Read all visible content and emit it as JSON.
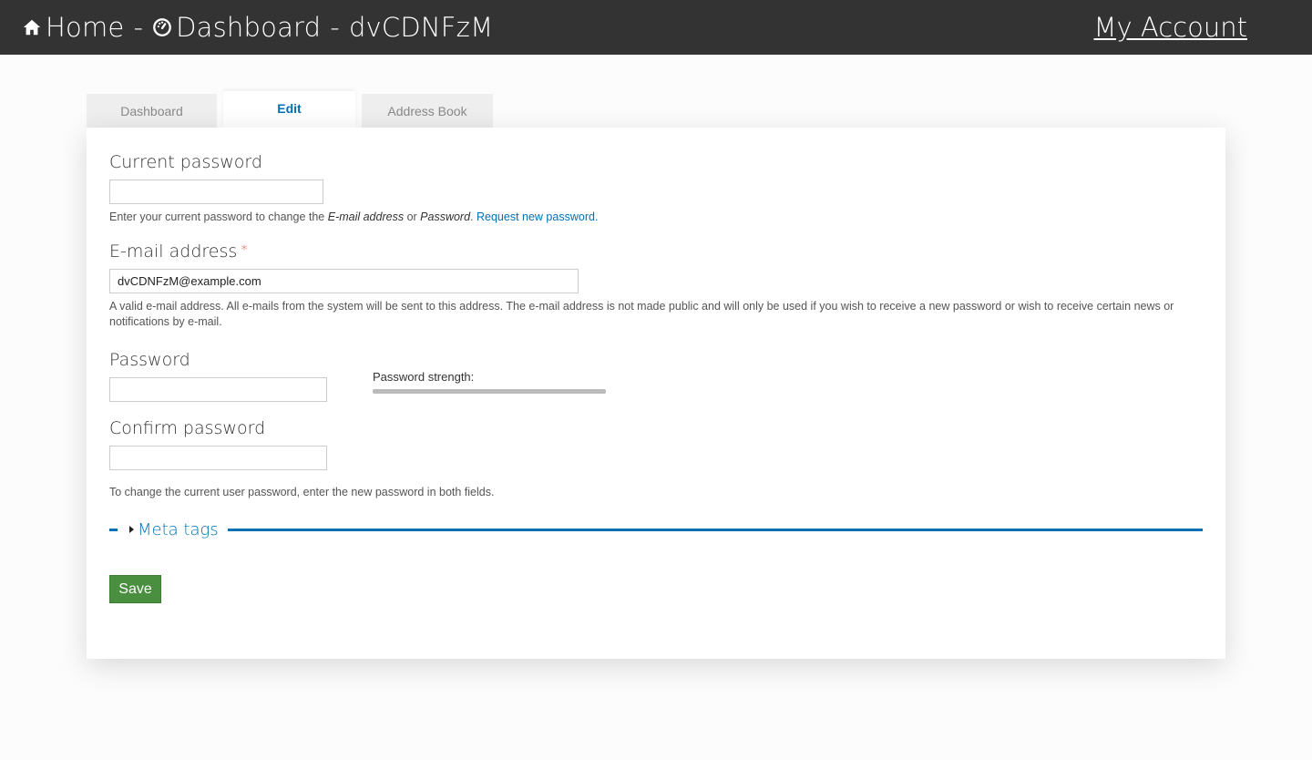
{
  "header": {
    "crumb_home": "Home",
    "crumb_sep1": "-",
    "crumb_dashboard": "Dashboard",
    "crumb_sep2": "-",
    "crumb_user": "dvCDNFzM",
    "account_link": "My Account",
    "bg_color": "#333333"
  },
  "tabs": [
    {
      "label": "Dashboard",
      "active": false
    },
    {
      "label": "Edit",
      "active": true
    },
    {
      "label": "Address Book",
      "active": false
    }
  ],
  "form": {
    "current_password": {
      "label": "Current password",
      "value": "",
      "desc_prefix": "Enter your current password to change the ",
      "desc_field1": "E-mail address",
      "desc_or": " or ",
      "desc_field2": "Password",
      "desc_dot": ". ",
      "desc_link": "Request new password",
      "desc_end": "."
    },
    "email": {
      "label": "E-mail address",
      "required_mark": "*",
      "value": "dvCDNFzM@example.com",
      "desc": "A valid e-mail address. All e-mails from the system will be sent to this address. The e-mail address is not made public and will only be used if you wish to receive a new password or wish to receive certain news or notifications by e-mail."
    },
    "password": {
      "label": "Password",
      "value": "",
      "strength_label": "Password strength:",
      "strength_value": 0
    },
    "confirm_password": {
      "label": "Confirm password",
      "value": "",
      "desc": "To change the current user password, enter the new password in both fields."
    },
    "meta_tags": {
      "label": "Meta tags",
      "expanded": false
    },
    "save_label": "Save"
  },
  "colors": {
    "link": "#0071b3",
    "save_button": "#4a8e3f",
    "required": "#e0483d"
  }
}
